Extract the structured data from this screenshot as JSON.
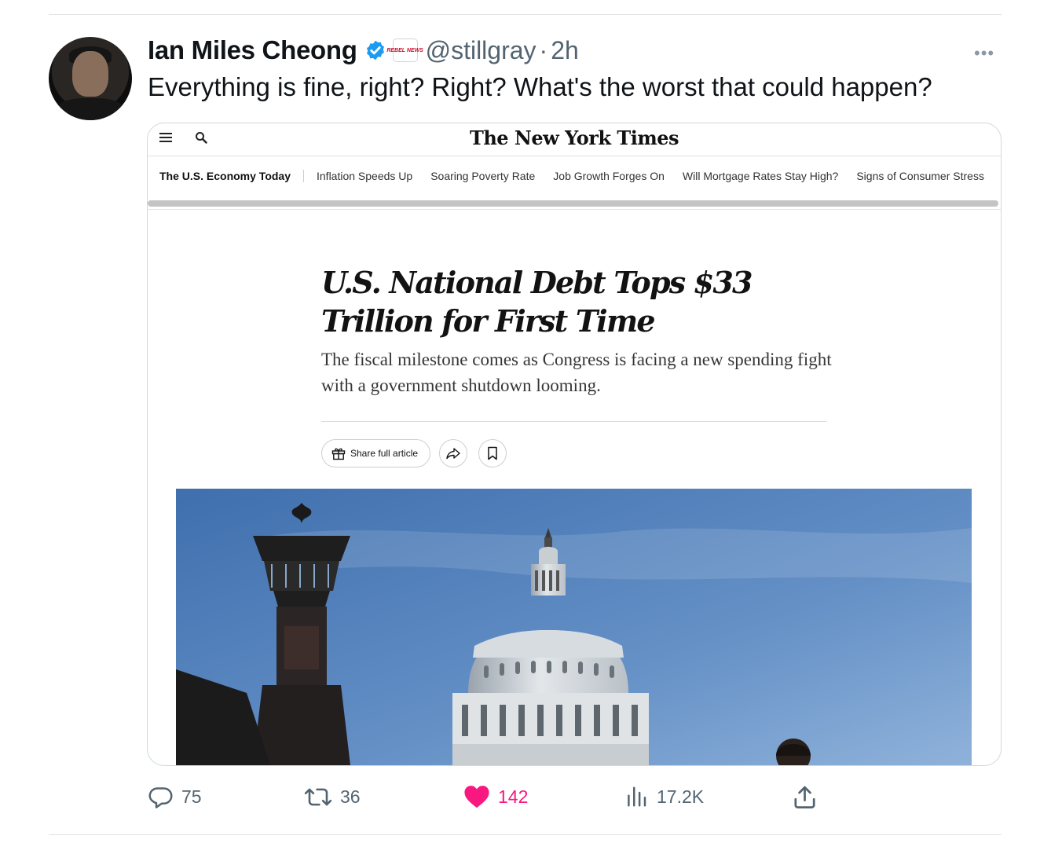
{
  "tweet": {
    "author_name": "Ian Miles Cheong",
    "affiliation_badge": "REBEL NEWS",
    "handle": "@stillgray",
    "separator": "·",
    "time": "2h",
    "more": "•••",
    "text": "Everything is fine, right? Right? What's the worst that could happen?"
  },
  "article": {
    "logo": "The New York Times",
    "nav_first": "The U.S. Economy Today",
    "nav_items": [
      "Inflation Speeds Up",
      "Soaring Poverty Rate",
      "Job Growth Forges On",
      "Will Mortgage Rates Stay High?",
      "Signs of Consumer Stress"
    ],
    "headline": "U.S. National Debt Tops $33 Trillion for First Time",
    "summary": "The fiscal milestone comes as Congress is facing a new spending fight with a government shutdown looming.",
    "share_label": "Share full article"
  },
  "actions": {
    "replies": "75",
    "reposts": "36",
    "likes": "142",
    "views": "17.2K"
  },
  "colors": {
    "verified": "#1d9bf0",
    "like": "#f91880",
    "muted": "#536471"
  }
}
